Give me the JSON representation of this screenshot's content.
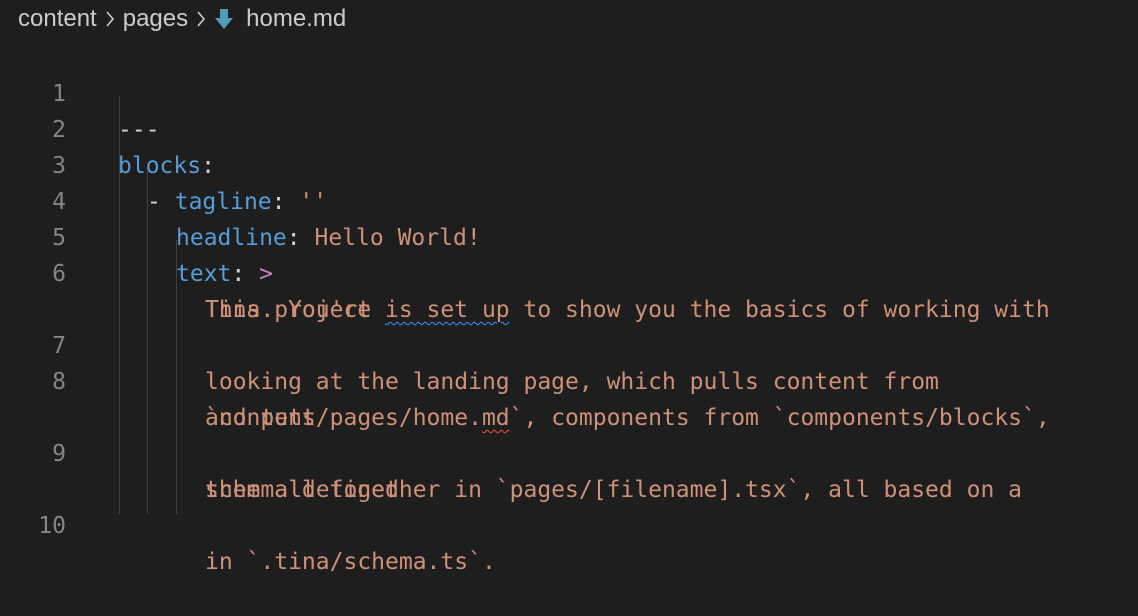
{
  "breadcrumb": {
    "folder1": "content",
    "folder2": "pages",
    "file": "home.md",
    "separator_icon": "chevron-right-icon",
    "file_icon": "markdown-file-icon",
    "file_icon_color": "#519aba"
  },
  "colors": {
    "background": "#1e1e1e",
    "key": "#569cd6",
    "string": "#ce9178",
    "line_number": "#858585",
    "folded_scalar_indicator": "#c586c0",
    "spelling_squiggle": "#3794ff",
    "error_squiggle": "#f14c4c"
  },
  "editor": {
    "line_numbers": [
      "1",
      "2",
      "3",
      "4",
      "5",
      "6",
      "7",
      "8",
      "9",
      "10"
    ],
    "line1": {
      "text": "---"
    },
    "line2": {
      "key": "blocks",
      "colon": ":"
    },
    "line3": {
      "dash": "-",
      "key": "tagline",
      "colon": ":",
      "value": "''"
    },
    "line4": {
      "key": "headline",
      "colon": ":",
      "value": "Hello World!"
    },
    "line5": {
      "key": "text",
      "colon": ":",
      "indicator": ">"
    },
    "line6": {
      "seg1": "This project ",
      "squiggle": "is set up",
      "seg2": " to show you the basics of working with",
      "wrap": "Tina. You're"
    },
    "line7": {
      "text": "looking at the landing page, which pulls content from"
    },
    "line8": {
      "seg1": "`content/pages/home.",
      "squiggle": "md",
      "seg2": "`, components from `components/blocks`,",
      "wrap": "and puts"
    },
    "line9": {
      "text": "them all together in `pages/[filename].tsx`, all based on a",
      "wrap": "schema defined"
    },
    "line10": {
      "text": "in `.tina/schema.ts`."
    }
  }
}
